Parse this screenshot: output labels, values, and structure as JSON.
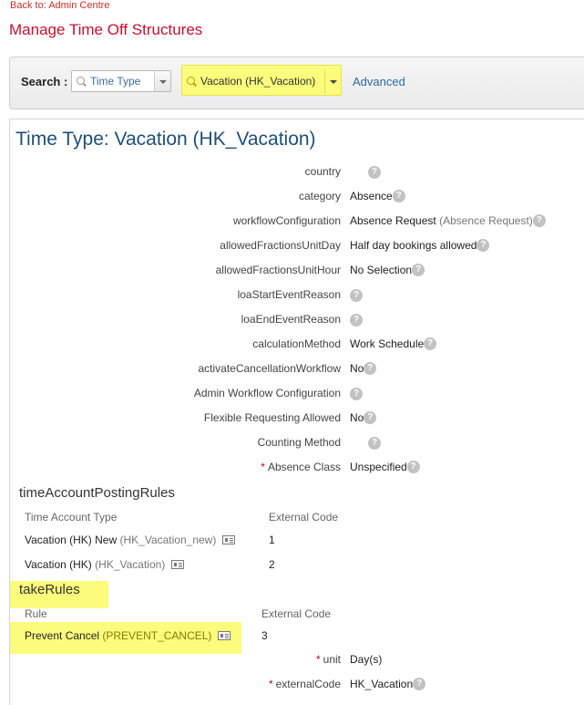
{
  "nav": {
    "back_link": "Back to: Admin Centre"
  },
  "page": {
    "title": "Manage Time Off Structures"
  },
  "search": {
    "label": "Search :",
    "type_value": "Time Type",
    "object_value": "Vacation (HK_Vacation)",
    "advanced_label": "Advanced"
  },
  "detail": {
    "title": "Time Type: Vacation (HK_Vacation)",
    "fields": [
      {
        "label": "country",
        "value": "",
        "secondary": "",
        "required": false
      },
      {
        "label": "category",
        "value": "Absence",
        "secondary": "",
        "required": false
      },
      {
        "label": "workflowConfiguration",
        "value": "Absence Request",
        "secondary": "(Absence Request)",
        "required": false
      },
      {
        "label": "allowedFractionsUnitDay",
        "value": "Half day bookings allowed",
        "secondary": "",
        "required": false
      },
      {
        "label": "allowedFractionsUnitHour",
        "value": "No Selection",
        "secondary": "",
        "required": false
      },
      {
        "label": "loaStartEventReason",
        "value": "",
        "secondary": "",
        "required": false
      },
      {
        "label": "loaEndEventReason",
        "value": "",
        "secondary": "",
        "required": false
      },
      {
        "label": "calculationMethod",
        "value": "Work Schedule",
        "secondary": "",
        "required": false
      },
      {
        "label": "activateCancellationWorkflow",
        "value": "No",
        "secondary": "",
        "required": false
      },
      {
        "label": "Admin Workflow Configuration",
        "value": "",
        "secondary": "",
        "required": false
      },
      {
        "label": "Flexible Requesting Allowed",
        "value": "No",
        "secondary": "",
        "required": false
      },
      {
        "label": "Counting Method",
        "value": "",
        "secondary": "",
        "required": false
      },
      {
        "label": "Absence Class",
        "value": "Unspecified",
        "secondary": "",
        "required": true
      }
    ],
    "help_glyph": "?",
    "required_mark": "*"
  },
  "posting_rules": {
    "title": "timeAccountPostingRules",
    "col_type": "Time Account Type",
    "col_code": "External Code",
    "rows": [
      {
        "name": "Vacation (HK) New",
        "code": "(HK_Vacation_new)",
        "ext": "1"
      },
      {
        "name": "Vacation (HK)",
        "code": "(HK_Vacation)",
        "ext": "2"
      }
    ]
  },
  "take_rules": {
    "title": "takeRules",
    "col_rule": "Rule",
    "col_code": "External Code",
    "rows": [
      {
        "name": "Prevent Cancel",
        "code": "(PREVENT_CANCEL)",
        "ext": "3"
      }
    ],
    "fields": [
      {
        "label": "unit",
        "value": "Day(s)",
        "required": true
      },
      {
        "label": "externalCode",
        "value": "HK_Vacation",
        "required": true
      }
    ]
  },
  "colors": {
    "brand_red": "#c8102e",
    "link_blue": "#2b6aa3",
    "highlight": "#fbfc7c"
  }
}
